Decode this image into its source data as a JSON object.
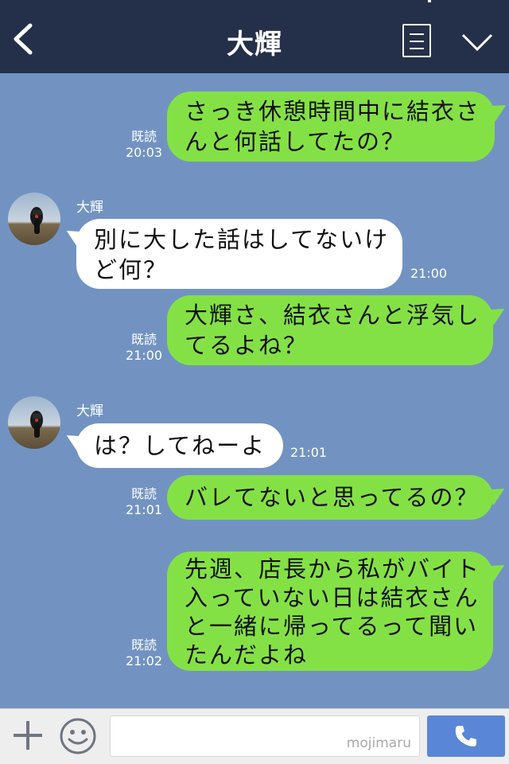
{
  "header": {
    "title": "大輝"
  },
  "messages": [
    {
      "dir": "out",
      "text": "さっき休憩時間中に結衣さんと何話してたの？",
      "read": "既読",
      "time": "20:03"
    },
    {
      "dir": "in",
      "sender": "大輝",
      "text": "別に大した話はしてないけど何？",
      "time": "21:00"
    },
    {
      "dir": "out",
      "text": "大輝さ、結衣さんと浮気してるよね？",
      "read": "既読",
      "time": "21:00"
    },
    {
      "dir": "in",
      "sender": "大輝",
      "text": "は？してねーよ",
      "time": "21:01"
    },
    {
      "dir": "out",
      "text": "バレてないと思ってるの？",
      "read": "既読",
      "time": "21:01"
    },
    {
      "dir": "out",
      "text": "先週、店長から私がバイト入っていない日は結衣さんと一緒に帰ってるって聞いたんだよね",
      "read": "既読",
      "time": "21:02"
    }
  ],
  "lines": {
    "m1": [
      "さっき休憩時間中に結衣さ",
      "んと何話してたの？"
    ],
    "m2": [
      "別に大した話はしてないけ",
      "ど何？"
    ],
    "m3": [
      "大輝さ、結衣さんと浮気し",
      "てるよね？"
    ],
    "m6": [
      "先週、店長から私がバイト",
      "入っていない日は結衣さん",
      "と一緒に帰ってるって聞い",
      "たんだよね"
    ]
  },
  "composer": {
    "placeholder": "mojimaru"
  },
  "icons": [
    "back-arrow-icon",
    "menu-icon",
    "chevron-down-icon",
    "plus-icon",
    "emoji-icon",
    "phone-icon"
  ],
  "colors": {
    "header": "#243049",
    "background": "#7293c2",
    "out_bubble": "#84e145",
    "in_bubble": "#ffffff",
    "call_button": "#5a86d8"
  }
}
